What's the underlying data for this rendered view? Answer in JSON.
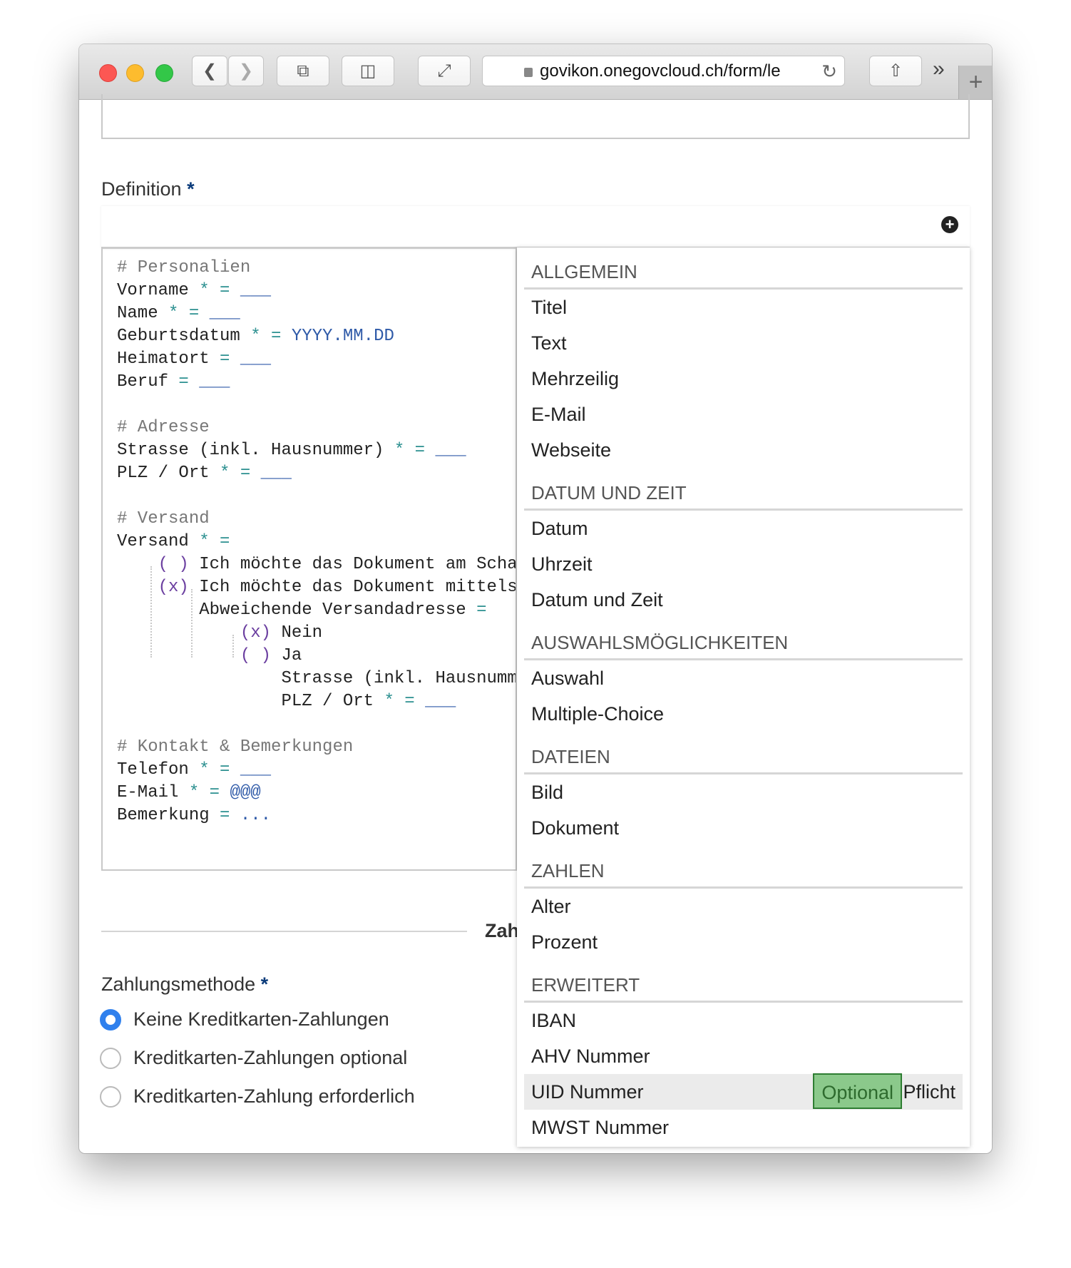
{
  "browser": {
    "url": "govikon.onegovcloud.ch/form/le",
    "icons": [
      "back-icon",
      "forward-icon",
      "tabs-icon",
      "sidebar-icon",
      "fullscreen-icon",
      "lock-icon",
      "reload-icon",
      "share-icon",
      "overflow-icon",
      "new-tab-icon"
    ],
    "more_label": "»",
    "new_tab_label": "+"
  },
  "form": {
    "definition_label": "Definition",
    "required_mark": "*",
    "add_icon": "plus-circle-icon",
    "code_lines": [
      [
        [
          "comment",
          "# Personalien"
        ]
      ],
      [
        [
          "key",
          "Vorname "
        ],
        [
          "op",
          "* = "
        ],
        [
          "val",
          "___"
        ]
      ],
      [
        [
          "key",
          "Name "
        ],
        [
          "op",
          "* = "
        ],
        [
          "val",
          "___"
        ]
      ],
      [
        [
          "key",
          "Geburtsdatum "
        ],
        [
          "op",
          "* = "
        ],
        [
          "val",
          "YYYY.MM.DD"
        ]
      ],
      [
        [
          "key",
          "Heimatort "
        ],
        [
          "op",
          "= "
        ],
        [
          "val",
          "___"
        ]
      ],
      [
        [
          "key",
          "Beruf "
        ],
        [
          "op",
          "= "
        ],
        [
          "val",
          "___"
        ]
      ],
      [],
      [
        [
          "comment",
          "# Adresse"
        ]
      ],
      [
        [
          "key",
          "Strasse (inkl. Hausnummer) "
        ],
        [
          "op",
          "* = "
        ],
        [
          "val",
          "___"
        ]
      ],
      [
        [
          "key",
          "PLZ / Ort "
        ],
        [
          "op",
          "* = "
        ],
        [
          "val",
          "___"
        ]
      ],
      [],
      [
        [
          "comment",
          "# Versand"
        ]
      ],
      [
        [
          "key",
          "Versand "
        ],
        [
          "op",
          "* ="
        ]
      ],
      [
        [
          "key",
          "    "
        ],
        [
          "radio",
          "( )"
        ],
        [
          "key",
          " Ich möchte das Dokument am Scha"
        ]
      ],
      [
        [
          "key",
          "    "
        ],
        [
          "radio",
          "(x)"
        ],
        [
          "key",
          " Ich möchte das Dokument mittels"
        ]
      ],
      [
        [
          "key",
          "        Abweichende Versandadresse "
        ],
        [
          "op",
          "="
        ]
      ],
      [
        [
          "key",
          "            "
        ],
        [
          "radio",
          "(x)"
        ],
        [
          "key",
          " Nein"
        ]
      ],
      [
        [
          "key",
          "            "
        ],
        [
          "radio",
          "( )"
        ],
        [
          "key",
          " Ja"
        ]
      ],
      [
        [
          "key",
          "                Strasse (inkl. Hausnumm"
        ]
      ],
      [
        [
          "key",
          "                PLZ / Ort "
        ],
        [
          "op",
          "* = "
        ],
        [
          "val",
          "___"
        ]
      ],
      [],
      [
        [
          "comment",
          "# Kontakt & Bemerkungen"
        ]
      ],
      [
        [
          "key",
          "Telefon "
        ],
        [
          "op",
          "* = "
        ],
        [
          "val",
          "___"
        ]
      ],
      [
        [
          "key",
          "E-Mail "
        ],
        [
          "op",
          "* = "
        ],
        [
          "val",
          "@@@"
        ]
      ],
      [
        [
          "key",
          "Bemerkung "
        ],
        [
          "op",
          "= "
        ],
        [
          "val",
          "..."
        ]
      ]
    ],
    "section_title_partial": "Zah",
    "payment_label": "Zahlungsmethode",
    "payment_options": [
      {
        "label": "Keine Kreditkarten-Zahlungen",
        "selected": true
      },
      {
        "label": "Kreditkarten-Zahlungen optional",
        "selected": false
      },
      {
        "label": "Kreditkarten-Zahlung erforderlich",
        "selected": false
      }
    ]
  },
  "dropdown": {
    "sections": [
      {
        "title": "ALLGEMEIN",
        "items": [
          "Titel",
          "Text",
          "Mehrzeilig",
          "E-Mail",
          "Webseite"
        ]
      },
      {
        "title": "DATUM UND ZEIT",
        "items": [
          "Datum",
          "Uhrzeit",
          "Datum und Zeit"
        ]
      },
      {
        "title": "AUSWAHLSMÖGLICHKEITEN",
        "items": [
          "Auswahl",
          "Multiple-Choice"
        ]
      },
      {
        "title": "DATEIEN",
        "items": [
          "Bild",
          "Dokument"
        ]
      },
      {
        "title": "ZAHLEN",
        "items": [
          "Alter",
          "Prozent"
        ]
      },
      {
        "title": "ERWEITERT",
        "items": [
          "IBAN",
          "AHV Nummer",
          "UID Nummer",
          "MWST Nummer"
        ]
      }
    ],
    "hovered_item": "UID Nummer",
    "optional_label": "Optional",
    "required_label": "Pflicht"
  },
  "colors": {
    "accent_green": "#8bc98b",
    "radio_blue": "#2f80ed",
    "required_blue": "#0b3b7a"
  }
}
